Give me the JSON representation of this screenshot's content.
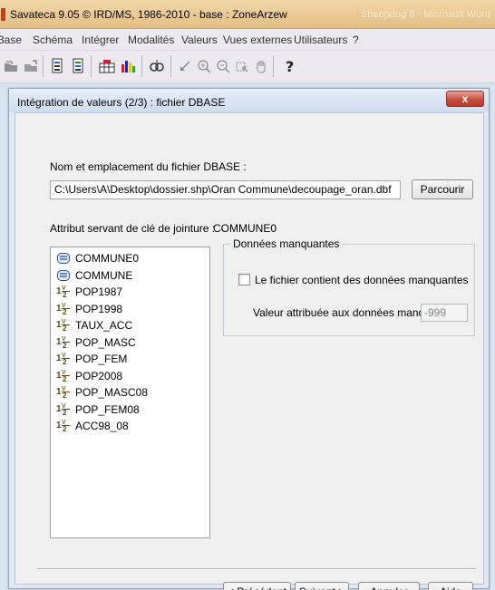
{
  "app": {
    "title": "Savateca 9.05 © IRD/MS, 1986-2010  -  base : ZoneArzew",
    "title_ghost": "Sheepdog 8 - Microsoft Word"
  },
  "menu": [
    "3ase",
    "Schéma",
    "Intégrer",
    "Modalités",
    "Valeurs",
    "Vues externes",
    "Utilisateurs",
    "?"
  ],
  "toolbar_icons": [
    "open-icon",
    "open-file-icon",
    "page-icon",
    "page-alt-icon",
    "grid-icon",
    "chart-icon",
    "search-icon",
    "pointer-icon",
    "zoom-in-icon",
    "zoom-out-icon",
    "select-icon",
    "hand-icon",
    "help-icon"
  ],
  "dialog": {
    "title": "Intégration de valeurs (2/3) : fichier DBASE",
    "file_label": "Nom et emplacement du fichier DBASE :",
    "file_path": "C:\\Users\\A\\Desktop\\dossier.shp\\Oran Commune\\decoupage_oran.dbf",
    "browse_label": "Parcourir",
    "join_key_label": "Attribut servant de clé de jointure :",
    "join_key_value": "COMMUNE0",
    "attributes": [
      {
        "name": "COMMUNE0",
        "kind": "text"
      },
      {
        "name": "COMMUNE",
        "kind": "text"
      },
      {
        "name": "POP1987",
        "kind": "numeric"
      },
      {
        "name": "POP1998",
        "kind": "numeric"
      },
      {
        "name": "TAUX_ACC",
        "kind": "numeric"
      },
      {
        "name": "POP_MASC",
        "kind": "numeric"
      },
      {
        "name": "POP_FEM",
        "kind": "numeric"
      },
      {
        "name": "POP2008",
        "kind": "numeric"
      },
      {
        "name": "POP_MASC08",
        "kind": "numeric"
      },
      {
        "name": "POP_FEM08",
        "kind": "numeric"
      },
      {
        "name": "ACC98_08",
        "kind": "numeric"
      }
    ],
    "missing_group_label": "Données manquantes",
    "missing_checkbox_label": "Le fichier contient des données manquantes",
    "missing_checked": false,
    "missing_value_label": "Valeur attribuée aux données manquantes :",
    "missing_value": "-999",
    "buttons": {
      "previous": "< Précédent",
      "next": "Suivant >",
      "cancel": "Annuler",
      "help": "Aide"
    },
    "close_glyph": "x"
  }
}
